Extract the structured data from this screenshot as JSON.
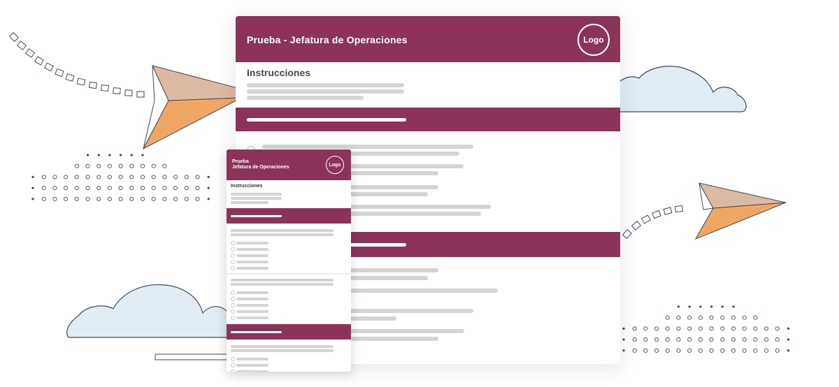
{
  "colors": {
    "brand": "#8b3359",
    "placeholder_bar": "#d4d4d4",
    "cloud_fill": "#e2ecf5",
    "plane_orange": "#f0a766",
    "plane_tan": "#dcbaa1"
  },
  "icons": [
    "paper-plane-icon",
    "cloud-icon",
    "dashed-flight-path",
    "dot-pattern"
  ],
  "doc_large": {
    "title": "Prueba - Jefatura de Operaciones",
    "logo": "Logo",
    "instructions": "Instrucciones"
  },
  "doc_small": {
    "title_line1": "Prueba",
    "title_line2": "Jefatura de Operaciones",
    "logo": "Logo",
    "instructions": "Instrucciones"
  }
}
